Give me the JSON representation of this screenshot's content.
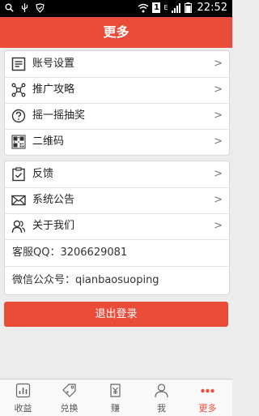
{
  "status_bar": {
    "time": "22:52",
    "sim_badge": "1",
    "network_type": "E"
  },
  "header": {
    "title": "更多"
  },
  "group_one": [
    {
      "label": "账号设置",
      "icon": "settings-list-icon"
    },
    {
      "label": "推广攻略",
      "icon": "share-network-icon"
    },
    {
      "label": "摇一摇抽奖",
      "icon": "question-circle-icon"
    },
    {
      "label": "二维码",
      "icon": "qr-code-icon"
    }
  ],
  "group_two": [
    {
      "label": "反馈",
      "icon": "feedback-clipboard-icon"
    },
    {
      "label": "系统公告",
      "icon": "mail-envelope-icon"
    },
    {
      "label": "关于我们",
      "icon": "people-icon"
    }
  ],
  "contact": {
    "qq": "客服QQ：3206629081",
    "wechat": "微信公众号：qianbaosuoping"
  },
  "logout_label": "退出登录",
  "chevron": ">",
  "tabs": [
    {
      "label": "收益",
      "icon": "bar-chart-icon"
    },
    {
      "label": "兑换",
      "icon": "tag-icon"
    },
    {
      "label": "赚",
      "icon": "yen-bag-icon"
    },
    {
      "label": "我",
      "icon": "person-icon"
    },
    {
      "label": "更多",
      "icon": "more-dots-icon"
    }
  ],
  "colors": {
    "accent": "#ea4c3a",
    "background": "#ececec"
  }
}
